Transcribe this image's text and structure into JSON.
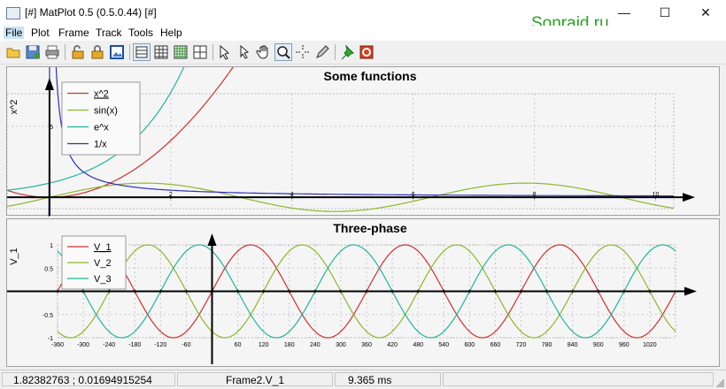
{
  "window": {
    "title": "[#] MatPlot 0.5 (0.5.0.44) [#]",
    "minimize": "—",
    "maximize": "☐",
    "close": "✕"
  },
  "watermark": "Sonraid.ru",
  "menu": [
    "File",
    "Plot",
    "Frame",
    "Track",
    "Tools",
    "Help"
  ],
  "toolbar_icons": [
    "open-icon",
    "save-icon",
    "print-icon",
    "lock-open-icon",
    "lock-closed-icon",
    "export-image-icon",
    "grid-mode-1-icon",
    "grid-mode-2-icon",
    "grid-mode-3-icon",
    "grid-mode-4-icon",
    "pointer-icon",
    "pointer-select-icon",
    "hand-pan-icon",
    "zoom-icon",
    "crosshair-icon",
    "pen-icon",
    "pin-icon",
    "record-icon"
  ],
  "status": {
    "coords": "1.82382763 ; 0.01694915254",
    "track": "Frame2.V_1",
    "time": "9.365 ms"
  },
  "chart_data": [
    {
      "type": "line",
      "title": "Some functions",
      "ylabel": "x^2",
      "xlabel": "",
      "xlim": [
        -0.7,
        10.3
      ],
      "ylim": [
        -0.8,
        7.3
      ],
      "x_ticks": [
        "2",
        "4",
        "6",
        "8",
        "10"
      ],
      "y_ticks": [
        "5"
      ],
      "legend_position": "top-left",
      "grid": true,
      "series": [
        {
          "name": "x^2",
          "color": "#d03030",
          "function": "x^2"
        },
        {
          "name": "sin(x)",
          "color": "#8cb82a",
          "function": "sin(x)"
        },
        {
          "name": "e^x",
          "color": "#22b59b",
          "function": "e^x"
        },
        {
          "name": "1/x",
          "color": "#3030b8",
          "function": "1/x"
        }
      ]
    },
    {
      "type": "line",
      "title": "Three-phase",
      "ylabel": "V_1",
      "xlabel": "",
      "xlim": [
        -360,
        1080
      ],
      "ylim": [
        -1,
        1
      ],
      "x_ticks": [
        "-360",
        "-300",
        "-240",
        "-180",
        "-120",
        "-60",
        "60",
        "120",
        "180",
        "240",
        "300",
        "360",
        "420",
        "480",
        "540",
        "600",
        "660",
        "720",
        "780",
        "840",
        "900",
        "960",
        "1020"
      ],
      "y_ticks": [
        "1",
        "0.5",
        "-0.5",
        "-1"
      ],
      "legend_position": "top-left",
      "grid": true,
      "series": [
        {
          "name": "V_1",
          "color": "#d03030",
          "function": "sin(x)"
        },
        {
          "name": "V_2",
          "color": "#8cb82a",
          "function": "sin(x-120)"
        },
        {
          "name": "V_3",
          "color": "#22b59b",
          "function": "sin(x+120)"
        }
      ]
    }
  ]
}
